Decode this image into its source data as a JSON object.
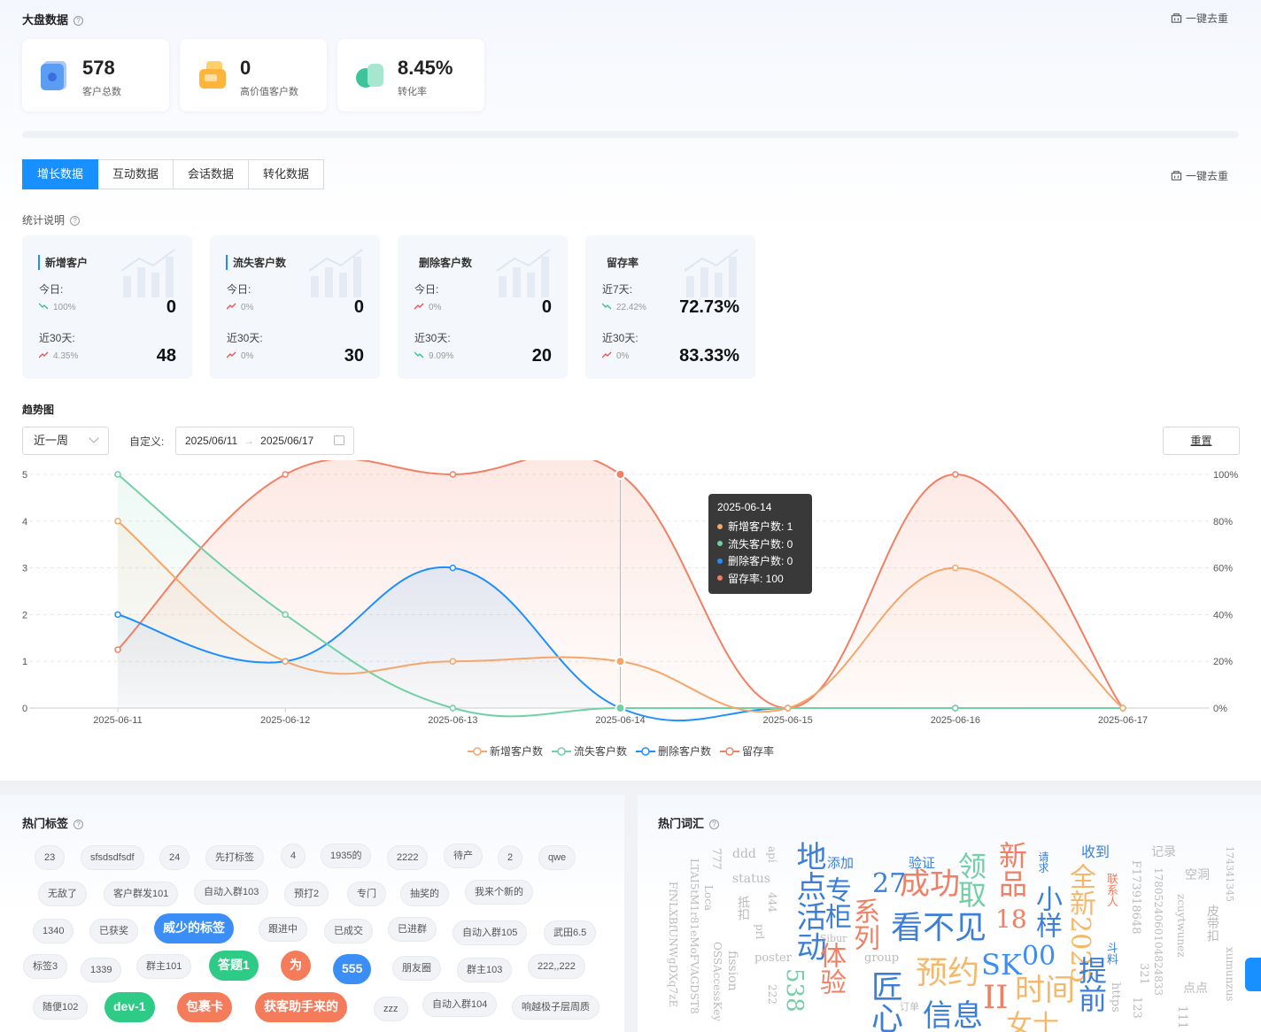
{
  "overview": {
    "title": "大盘数据",
    "dedup_label": "一键去重",
    "cards": [
      {
        "value": "578",
        "label": "客户总数"
      },
      {
        "value": "0",
        "label": "高价值客户数"
      },
      {
        "value": "8.45%",
        "label": "转化率"
      }
    ]
  },
  "tabs": [
    "增长数据",
    "互动数据",
    "会话数据",
    "转化数据"
  ],
  "tabs_dedup_label": "一键去重",
  "note": "统计说明",
  "stats": [
    {
      "title": "新增客户",
      "r1_label": "今日:",
      "r1_pct": "100%",
      "r1_trend": "down",
      "r1_value": "0",
      "r2_label": "近30天:",
      "r2_pct": "4.35%",
      "r2_trend": "up",
      "r2_value": "48"
    },
    {
      "title": "流失客户数",
      "r1_label": "今日:",
      "r1_pct": "0%",
      "r1_trend": "up",
      "r1_value": "0",
      "r2_label": "近30天:",
      "r2_pct": "0%",
      "r2_trend": "up",
      "r2_value": "30"
    },
    {
      "title": "删除客户数",
      "r1_label": "今日:",
      "r1_pct": "0%",
      "r1_trend": "up",
      "r1_value": "0",
      "r2_label": "近30天:",
      "r2_pct": "9.09%",
      "r2_trend": "down",
      "r2_value": "20"
    },
    {
      "title": "留存率",
      "r1_label": "近7天:",
      "r1_pct": "22.42%",
      "r1_trend": "down",
      "r1_value": "72.73%",
      "r2_label": "近30天:",
      "r2_pct": "0%",
      "r2_trend": "up",
      "r2_value": "83.33%"
    }
  ],
  "trend": {
    "title": "趋势图",
    "period": "近一周",
    "custom_label": "自定义:",
    "start_date": "2025/06/11",
    "end_date": "2025/06/17",
    "reset_label": "重置"
  },
  "chart_data": {
    "type": "line",
    "x": [
      "2025-06-11",
      "2025-06-12",
      "2025-06-13",
      "2025-06-14",
      "2025-06-15",
      "2025-06-16",
      "2025-06-17"
    ],
    "y_left": {
      "range": [
        0,
        5
      ],
      "ticks": [
        "0",
        "1",
        "2",
        "3",
        "4",
        "5"
      ]
    },
    "y_right": {
      "range": [
        0,
        100
      ],
      "ticks": [
        "0%",
        "20%",
        "40%",
        "60%",
        "80%",
        "100%"
      ]
    },
    "series": [
      {
        "name": "新增客户数",
        "color": "#f5a66b",
        "axis": "left",
        "values": [
          4,
          1,
          1,
          1,
          0,
          3,
          0
        ]
      },
      {
        "name": "流失客户数",
        "color": "#72d0a6",
        "axis": "left",
        "values": [
          5,
          2,
          0,
          0,
          0,
          0,
          0
        ]
      },
      {
        "name": "删除客户数",
        "color": "#1e8fff",
        "axis": "left",
        "values": [
          2,
          1,
          3,
          0,
          0,
          0,
          0
        ]
      },
      {
        "name": "留存率",
        "color": "#f27f63",
        "axis": "right",
        "values": [
          25,
          100,
          100,
          100,
          0,
          100,
          0
        ]
      }
    ],
    "grid": true,
    "legend": "bottom-center",
    "tooltip": {
      "title": "2025-06-14",
      "rows": [
        "新增客户数: 1",
        "流失客户数: 0",
        "删除客户数: 0",
        "留存率: 100"
      ]
    }
  },
  "hot_tags": {
    "title": "热门标签",
    "tags": [
      {
        "text": "23"
      },
      {
        "text": "sfsdsdfsdf"
      },
      {
        "text": "24"
      },
      {
        "text": "先打标签"
      },
      {
        "text": "4"
      },
      {
        "text": "1935的"
      },
      {
        "text": "2222"
      },
      {
        "text": "待产"
      },
      {
        "text": "2"
      },
      {
        "text": "qwe"
      },
      {
        "text": "无敌了"
      },
      {
        "text": "客户群发101"
      },
      {
        "text": "自动入群103"
      },
      {
        "text": "预打2"
      },
      {
        "text": "专门"
      },
      {
        "text": "抽奖的"
      },
      {
        "text": "我来个新的"
      },
      {
        "text": "1340"
      },
      {
        "text": "已获奖"
      },
      {
        "text": "威少的标签",
        "color": "#3b8ef5"
      },
      {
        "text": "跟进中"
      },
      {
        "text": "已成交"
      },
      {
        "text": "已进群"
      },
      {
        "text": "自动入群105"
      },
      {
        "text": "武田6.5"
      },
      {
        "text": "标签3"
      },
      {
        "text": "1339"
      },
      {
        "text": "群主101"
      },
      {
        "text": "答题1",
        "color": "#2ecb86"
      },
      {
        "text": "为",
        "color": "#f57c5b"
      },
      {
        "text": "555",
        "color": "#3b8ef5"
      },
      {
        "text": "朋友圈"
      },
      {
        "text": "群主103"
      },
      {
        "text": "222,,222"
      },
      {
        "text": "随便102"
      },
      {
        "text": "dev-1",
        "color": "#2ecb86"
      },
      {
        "text": "包裹卡",
        "color": "#f57c5b"
      },
      {
        "text": "获客助手来的",
        "color": "#f57c5b"
      },
      {
        "text": "zzz"
      },
      {
        "text": "自动入群104"
      },
      {
        "text": "响越极子层周质"
      }
    ]
  },
  "hot_words": {
    "title": "热门词汇",
    "words": [
      {
        "text": "成功",
        "color": "#f27f63"
      },
      {
        "text": "看不见",
        "color": "#3b7fd8"
      },
      {
        "text": "预约",
        "color": "#f5b86b"
      },
      {
        "text": "时间",
        "color": "#f5b86b"
      },
      {
        "text": "信息",
        "color": "#3b7fd8"
      },
      {
        "text": "SK",
        "color": "#3b8ef5"
      },
      {
        "text": "00",
        "color": "#3b8ef5"
      },
      {
        "text": "II",
        "color": "#f27f63"
      },
      {
        "text": "27",
        "color": "#3b7fd8"
      },
      {
        "text": "18",
        "color": "#f27f63"
      },
      {
        "text": "新品",
        "color": "#f27f63"
      },
      {
        "text": "小样",
        "color": "#3b7fd8"
      },
      {
        "text": "全新2025",
        "color": "#f5b86b"
      },
      {
        "text": "地点活动",
        "color": "#3b7fd8"
      },
      {
        "text": "专柜",
        "color": "#3b7fd8"
      },
      {
        "text": "领取",
        "color": "#72d0a6"
      },
      {
        "text": "体验",
        "color": "#f27f63"
      },
      {
        "text": "系列",
        "color": "#f27f63"
      },
      {
        "text": "匠心",
        "color": "#3b7fd8"
      },
      {
        "text": "538",
        "color": "#72d0a6"
      },
      {
        "text": "提前",
        "color": "#3b7fd8"
      },
      {
        "text": "女士",
        "color": "#f5b86b"
      },
      {
        "text": "收到",
        "color": "#3b7fd8"
      },
      {
        "text": "添加",
        "color": "#3b7fd8"
      },
      {
        "text": "验证",
        "color": "#3b7fd8"
      },
      {
        "text": "记录",
        "color": "#bbbbbb"
      },
      {
        "text": "空洞",
        "color": "#bbbbbb"
      },
      {
        "text": "ddd",
        "color": "#bbbbbb"
      },
      {
        "text": "status",
        "color": "#bbbbbb"
      },
      {
        "text": "poster",
        "color": "#bbbbbb"
      },
      {
        "text": "group",
        "color": "#bbbbbb"
      },
      {
        "text": "Sibur",
        "color": "#bbbbbb"
      },
      {
        "text": "订单",
        "color": "#bbbbbb"
      },
      {
        "text": "联系人",
        "color": "#f27f63"
      },
      {
        "text": "请求",
        "color": "#3b7fd8"
      },
      {
        "text": "斗料",
        "color": "#3b7fd8"
      },
      {
        "text": "777",
        "color": "#bbbbbb"
      },
      {
        "text": "api",
        "color": "#bbbbbb"
      },
      {
        "text": "444",
        "color": "#bbbbbb"
      },
      {
        "text": "prl",
        "color": "#bbbbbb"
      },
      {
        "text": "222",
        "color": "#bbbbbb"
      },
      {
        "text": "fission",
        "color": "#bbbbbb"
      },
      {
        "text": "Loca",
        "color": "#bbbbbb"
      },
      {
        "text": "OSSAccessKey",
        "color": "#bbbbbb"
      },
      {
        "text": "LTAI5tM1r81eMoFVAGDST8",
        "color": "#bbbbbb"
      },
      {
        "text": "FfNLXBfUNWgDXq7zE",
        "color": "#bbbbbb"
      },
      {
        "text": "F173918648",
        "color": "#bbbbbb"
      },
      {
        "text": "1780524060104824833",
        "color": "#bbbbbb"
      },
      {
        "text": "zcuytwunez",
        "color": "#bbbbbb"
      },
      {
        "text": "174341345",
        "color": "#bbbbbb"
      },
      {
        "text": "xumunzus",
        "color": "#bbbbbb"
      },
      {
        "text": "321",
        "color": "#bbbbbb"
      },
      {
        "text": "123",
        "color": "#bbbbbb"
      },
      {
        "text": "111",
        "color": "#bbbbbb"
      },
      {
        "text": "https",
        "color": "#bbbbbb"
      },
      {
        "text": "点点",
        "color": "#bbbbbb"
      },
      {
        "text": "皮带扣",
        "color": "#bbbbbb"
      },
      {
        "text": "抵扣",
        "color": "#bbbbbb"
      }
    ]
  }
}
